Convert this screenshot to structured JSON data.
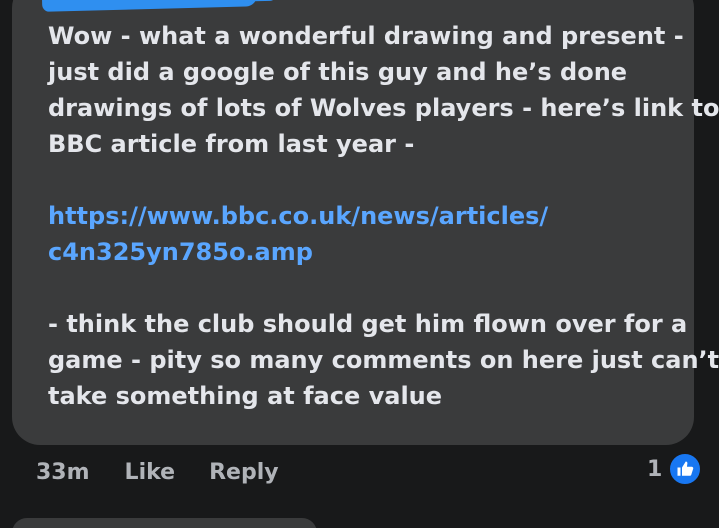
{
  "comment": {
    "lines": [
      "Wow - what a wonderful drawing and present -",
      "just did a google of this guy and he’s done",
      "drawings of lots of Wolves players - here’s link to",
      "BBC article from last year -",
      "https://www.bbc.co.uk/news/articles/",
      "c4n325yn785o.amp",
      "- think the club should get him flown over for a",
      "game - pity so many comments on here just can’t",
      "take something at face value"
    ]
  },
  "actions": {
    "timestamp": "33m",
    "like_label": "Like",
    "reply_label": "Reply"
  },
  "reactions": {
    "count": "1",
    "icon": "thumbs-up-icon",
    "badge_color": "#1877f2"
  },
  "colors": {
    "background": "#18191a",
    "bubble": "#3a3b3c",
    "text": "#e4e6eb",
    "link": "#5aa6ff",
    "muted": "#b0b3b8",
    "redaction": "#2f8ff0"
  }
}
